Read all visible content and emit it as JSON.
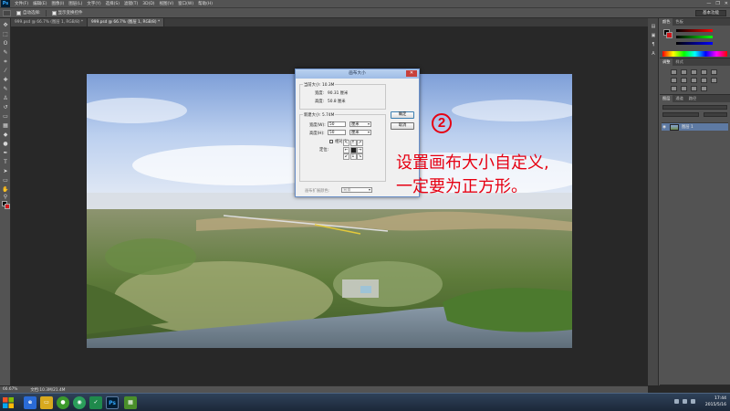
{
  "app": {
    "logo": "Ps",
    "menu": [
      "文件(F)",
      "编辑(E)",
      "图像(I)",
      "图层(L)",
      "文字(Y)",
      "选择(S)",
      "滤镜(T)",
      "3D(D)",
      "视图(V)",
      "窗口(W)",
      "帮助(H)"
    ],
    "window_controls": [
      "—",
      "❐",
      "✕"
    ]
  },
  "options_bar": {
    "auto_select_label": "自动选择:",
    "show_transform_label": "显示变换控件",
    "workspace": "基本功能"
  },
  "tabs": [
    {
      "label": "999.psd @ 66.7% (图层 1, RGB/8) *",
      "active": false
    },
    {
      "label": "999.psd @ 66.7% (图层 1, RGB/8) *",
      "active": true
    }
  ],
  "dialog": {
    "title": "画布大小",
    "close": "✕",
    "current_size": {
      "legend": "当前大小: 10.3M",
      "width_label": "宽度:",
      "width_value": "90.31 厘米",
      "height_label": "高度:",
      "height_value": "50.8 厘米"
    },
    "new_size": {
      "legend": "新建大小: 5.74M",
      "width_label": "宽度(W):",
      "width_value": "50",
      "width_unit": "厘米",
      "height_label": "高度(H):",
      "height_value": "50",
      "height_unit": "厘米",
      "relative_label": "相对(R)",
      "anchor_label": "定位:",
      "anchor_arrows": [
        "↖",
        "↑",
        "↗",
        "←",
        "",
        "→",
        "↙",
        "↓",
        "↘"
      ]
    },
    "extension_color_label": "画布扩展颜色:",
    "extension_color_value": "背景",
    "ok_label": "确定",
    "cancel_label": "取消"
  },
  "annotation": {
    "number": "2",
    "line1": "设置画布大小自定义,",
    "line2": "一定要为正方形。"
  },
  "panels": {
    "color_tabs": [
      "颜色",
      "色板"
    ],
    "adjust_tabs": [
      "调整",
      "样式"
    ],
    "layers_tabs": [
      "图层",
      "通道",
      "路径"
    ],
    "layer_name": "图层 1"
  },
  "status": {
    "zoom": "66.67%",
    "doc": "文档:10.3M/21.4M"
  },
  "taskbar": {
    "time": "17:44",
    "date": "2015/5/16"
  }
}
